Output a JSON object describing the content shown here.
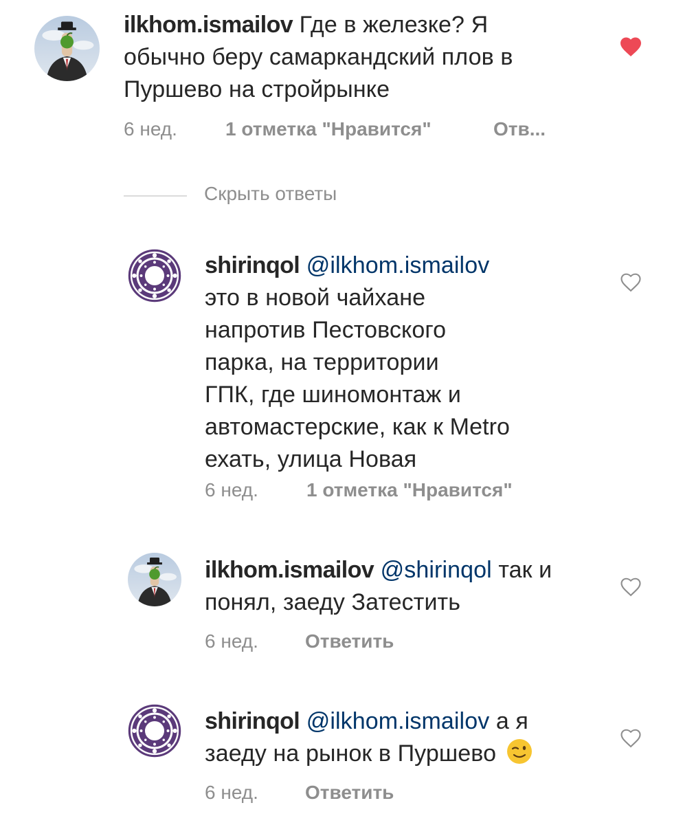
{
  "comments": [
    {
      "username": "ilkhom.ismailov",
      "mention": "",
      "lines": [
        "Где в железке? Я",
        "обычно беру самаркандский плов в",
        "Пуршево на стройрынке"
      ],
      "time": "6 нед.",
      "likes": "1 отметка \"Нравится\"",
      "reply": "Отв...",
      "liked": true,
      "avatar": "man-apple-avatar"
    },
    {
      "username": "shirinqol",
      "mention": "@ilkhom.ismailov",
      "lines": [
        "это в новой чайхане",
        "напротив Пестовского",
        "парка, на территории",
        "ГПК, где шиномонтаж и",
        "автомастерские, как к Metro",
        "ехать, улица Новая"
      ],
      "time": "6 нед.",
      "likes": "1 отметка \"Нравится\"",
      "reply": "",
      "liked": false,
      "avatar": "ornament-avatar"
    },
    {
      "username": "ilkhom.ismailov",
      "mention": "@shirinqol",
      "first_tail": "так и",
      "lines": [
        "понял, заеду  Затестить"
      ],
      "time": "6 нед.",
      "likes": "",
      "reply": "Ответить",
      "liked": false,
      "avatar": "man-apple-avatar"
    },
    {
      "username": "shirinqol",
      "mention": "@ilkhom.ismailov",
      "first_tail": "а я",
      "lines": [
        "заеду на рынок в Пуршево"
      ],
      "emoji": "winking-face",
      "time": "6 нед.",
      "likes": "",
      "reply": "Ответить",
      "liked": false,
      "avatar": "ornament-avatar"
    }
  ],
  "hide_replies_label": "Скрыть ответы",
  "colors": {
    "text": "#262626",
    "mention": "#003569",
    "meta": "#8e8e8e",
    "heart_liked": "#ed4956",
    "divider": "#dbdbdb",
    "avatar_ornament": "#5b3a7a"
  }
}
